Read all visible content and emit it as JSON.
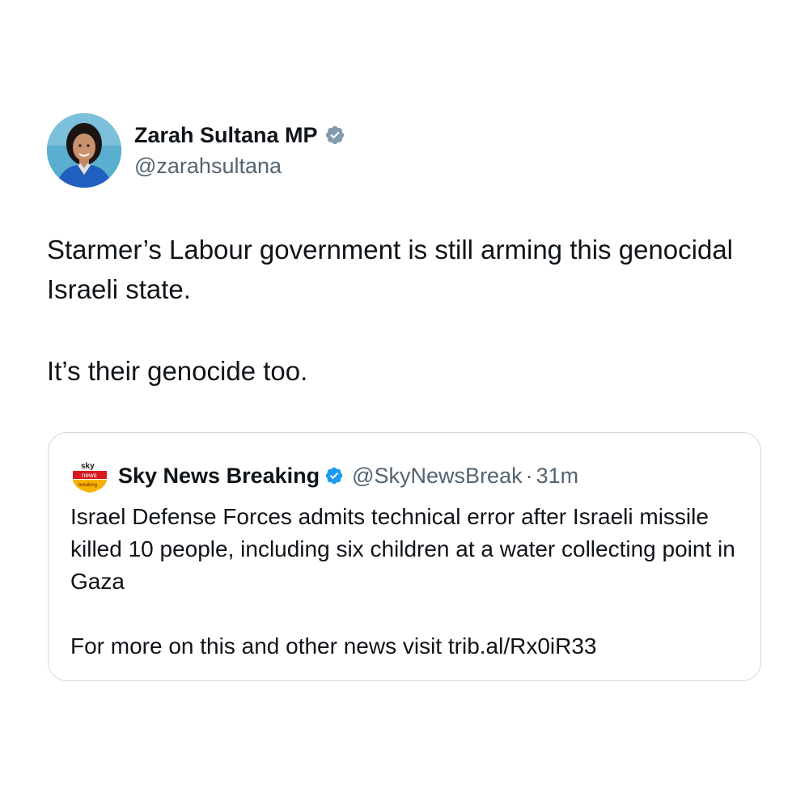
{
  "author": {
    "display_name": "Zarah Sultana MP",
    "handle": "@zarahsultana",
    "verified": true,
    "avatar_icon": "profile-photo",
    "badge_color": "#829aab"
  },
  "tweet": {
    "paragraphs": [
      "Starmer’s Labour government is still arming this genocidal Israeli state.",
      "It’s their genocide too."
    ]
  },
  "quoted_tweet": {
    "display_name": "Sky News Breaking",
    "handle": "@SkyNewsBreak",
    "separator": "·",
    "time": "31m",
    "verified": true,
    "badge_color": "#1d9bf0",
    "avatar_icon": "sky-news-breaking-logo",
    "avatar_logo_text": {
      "top": "sky",
      "middle": "news",
      "bottom": "breaking"
    },
    "paragraphs": [
      "Israel Defense Forces admits technical error after Israeli missile killed 10 people, including six children at a water collecting point in Gaza",
      "For more on this and other news visit trib.al/Rx0iR33"
    ]
  }
}
